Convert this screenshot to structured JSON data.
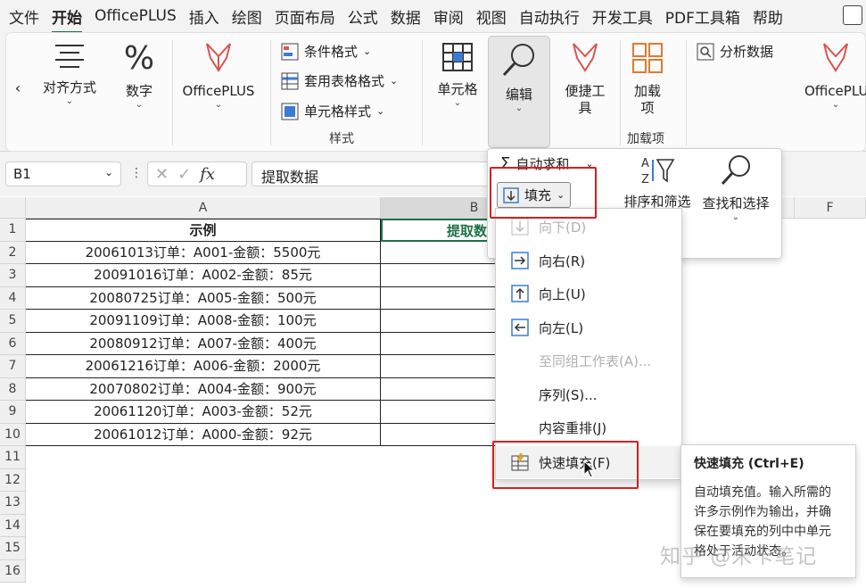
{
  "menu": {
    "items": [
      "文件",
      "开始",
      "OfficePLUS",
      "插入",
      "绘图",
      "页面布局",
      "公式",
      "数据",
      "审阅",
      "视图",
      "自动执行",
      "开发工具",
      "PDF工具箱",
      "帮助"
    ],
    "active_index": 1
  },
  "ribbon": {
    "scroll_left": "‹",
    "align": "对齐方式",
    "number": "数字",
    "officeplus": "OfficePLUS",
    "cond_format": "条件格式",
    "table_format": "套用表格格式",
    "cell_style": "单元格样式",
    "style_group": "样式",
    "cells": "单元格",
    "edit": "编辑",
    "quick_tools": "便捷工具",
    "addins": "加载项",
    "addins_group": "加载项",
    "analyze": "分析数据",
    "officeplus2": "OfficePLU"
  },
  "edit_panel": {
    "autosum": "自动求和",
    "fill": "填充",
    "sort_filter": "排序和筛选",
    "find_select": "查找和选择"
  },
  "fill_menu": {
    "down": "向下(D)",
    "right": "向右(R)",
    "up": "向上(U)",
    "left": "向左(L)",
    "across": "至同组工作表(A)...",
    "series": "序列(S)...",
    "justify": "内容重排(J)",
    "flash": "快速填充(F)"
  },
  "tooltip": {
    "title": "快速填充 (Ctrl+E)",
    "body": "自动填充值。输入所需的许多示例作为输出，并确保在要填充的列中中单元格处于活动状态。"
  },
  "formula_bar": {
    "cell_ref": "B1",
    "value": "提取数据"
  },
  "sheet": {
    "columns": [
      "A",
      "B",
      "F"
    ],
    "rows": [
      "1",
      "2",
      "3",
      "4",
      "5",
      "6",
      "7",
      "8",
      "9",
      "10",
      "11",
      "12",
      "13",
      "14",
      "15",
      "16"
    ],
    "header_a": "示例",
    "header_b": "提取数",
    "data": [
      "20061013订单：A001-金额：5500元",
      "20091016订单：A002-金额：85元",
      "20080725订单：A005-金额：500元",
      "20091109订单：A008-金额：100元",
      "20080912订单：A007-金额：400元",
      "20061216订单：A006-金额：2000元",
      "20070802订单：A004-金额：900元",
      "20061120订单：A003-金额：52元",
      "20061012订单：A000-金额：92元"
    ]
  },
  "watermark": "知乎 @米卡笔记",
  "colors": {
    "accent_green": "#1e7145",
    "highlight_red": "#d32020"
  }
}
